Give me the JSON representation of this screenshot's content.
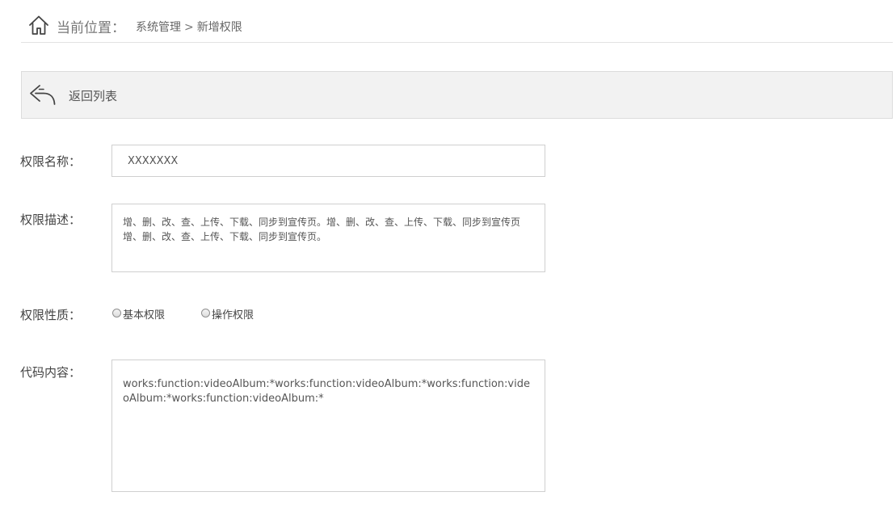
{
  "breadcrumb": {
    "label": "当前位置：",
    "path": [
      "系统管理",
      "新增权限"
    ],
    "separator": ">"
  },
  "toolbar": {
    "back_label": "返回列表",
    "back_icon": "back-arrow-icon"
  },
  "icons": {
    "home": "home-icon",
    "back": "back-arrow-icon"
  },
  "form": {
    "name": {
      "label": "权限名称：",
      "value": "XXXXXXX"
    },
    "description": {
      "label": "权限描述：",
      "value": "增、删、改、查、上传、下载、同步到宣传页。增、删、改、查、上传、下载、同步到宣传页增、删、改、查、上传、下载、同步到宣传页。"
    },
    "type": {
      "label": "权限性质：",
      "options": [
        "基本权限",
        "操作权限"
      ],
      "selected": null
    },
    "code": {
      "label": "代码内容：",
      "value": "works:function:videoAlbum:*works:function:videoAlbum:*works:function:videoAlbum:*works:function:videoAlbum:*"
    }
  },
  "colors": {
    "toolbar_bg": "#f2f2f2",
    "border": "#cfcfcf",
    "text": "#555555"
  }
}
